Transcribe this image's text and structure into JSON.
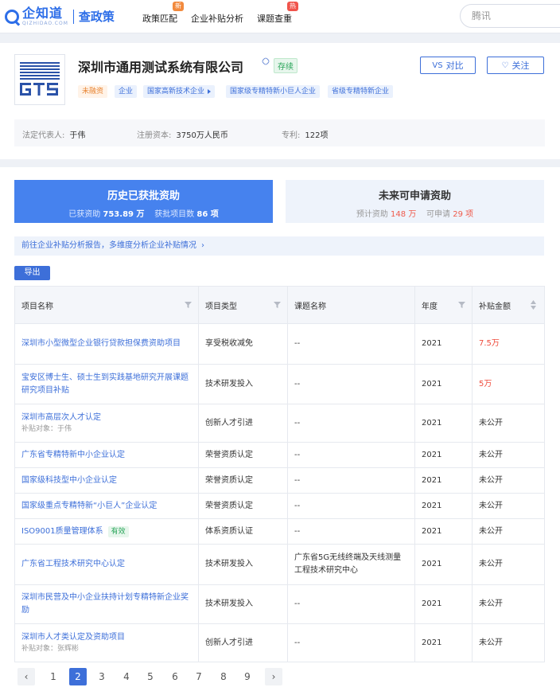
{
  "nav": {
    "logo_text": "企知道",
    "logo_sub_en": "QIZHIDAO.COM",
    "logo_product": "查政策",
    "items": [
      {
        "label": "政策匹配",
        "badge": "新"
      },
      {
        "label": "企业补贴分析",
        "badge": ""
      },
      {
        "label": "课题查重",
        "badge": "热"
      }
    ],
    "search_value": "腾讯"
  },
  "company": {
    "name": "深圳市通用测试系统有限公司",
    "status": "存续",
    "tags": [
      "未融资",
      "企业",
      "国家高新技术企业",
      "国家级专精特新小巨人企业",
      "省级专精特新企业"
    ],
    "compare_label": "对比",
    "follow_label": "关注",
    "info": [
      {
        "label": "法定代表人:",
        "value": "于伟"
      },
      {
        "label": "注册资本:",
        "value": "3750万人民币"
      },
      {
        "label": "专利:",
        "value": "122项"
      }
    ]
  },
  "summary": {
    "history": {
      "title": "历史已获批资助",
      "funds_label": "已获资助",
      "funds_value": "753.89 万",
      "count_label": "获批项目数",
      "count_value": "86 项"
    },
    "future": {
      "title": "未来可申请资助",
      "funds_label": "预计资助",
      "funds_value": "148 万",
      "count_label": "可申请",
      "count_value": "29 项"
    }
  },
  "report_link": "前往企业补贴分析报告，多维度分析企业补贴情况",
  "export_label": "导出",
  "table": {
    "headers": [
      "项目名称",
      "项目类型",
      "课题名称",
      "年度",
      "补贴金额"
    ],
    "rows": [
      {
        "name": "深圳市小型微型企业银行贷款担保费资助项目",
        "note": "",
        "badge": "",
        "type": "享受税收减免",
        "topic": "--",
        "year": "2021",
        "amount": "7.5万",
        "red": true
      },
      {
        "name": "宝安区博士生、硕士生到实践基地研究开展课题研究项目补贴",
        "note": "",
        "badge": "",
        "type": "技术研发投入",
        "topic": "--",
        "year": "2021",
        "amount": "5万",
        "red": true
      },
      {
        "name": "深圳市高层次人才认定",
        "note": "补贴对象：于伟",
        "badge": "",
        "type": "创新人才引进",
        "topic": "--",
        "year": "2021",
        "amount": "未公开",
        "red": false
      },
      {
        "name": "广东省专精特新中小企业认定",
        "note": "",
        "badge": "",
        "type": "荣誉资质认定",
        "topic": "--",
        "year": "2021",
        "amount": "未公开",
        "red": false
      },
      {
        "name": "国家级科技型中小企业认定",
        "note": "",
        "badge": "",
        "type": "荣誉资质认定",
        "topic": "--",
        "year": "2021",
        "amount": "未公开",
        "red": false
      },
      {
        "name": "国家级重点专精特新“小巨人”企业认定",
        "note": "",
        "badge": "",
        "type": "荣誉资质认定",
        "topic": "--",
        "year": "2021",
        "amount": "未公开",
        "red": false
      },
      {
        "name": "ISO9001质量管理体系",
        "note": "",
        "badge": "有效",
        "type": "体系资质认证",
        "topic": "--",
        "year": "2021",
        "amount": "未公开",
        "red": false
      },
      {
        "name": "广东省工程技术研究中心认定",
        "note": "",
        "badge": "",
        "type": "技术研发投入",
        "topic": "广东省5G无线终端及天线测量工程技术研究中心",
        "year": "2021",
        "amount": "未公开",
        "red": false
      },
      {
        "name": "深圳市民营及中小企业扶持计划专精特新企业奖励",
        "note": "",
        "badge": "",
        "type": "技术研发投入",
        "topic": "--",
        "year": "2021",
        "amount": "未公开",
        "red": false
      },
      {
        "name": "深圳市人才类认定及资助项目",
        "note": "补贴对象：张辉彬",
        "badge": "",
        "type": "创新人才引进",
        "topic": "--",
        "year": "2021",
        "amount": "未公开",
        "red": false
      }
    ]
  },
  "pagination": {
    "pages": [
      "1",
      "2",
      "3",
      "4",
      "5",
      "6",
      "7",
      "8",
      "9"
    ],
    "current": "2"
  },
  "colors": {
    "primary": "#3d6fd9",
    "accent_blue": "#4682ee",
    "red": "#ef4b3c",
    "green": "#2aa55a"
  }
}
